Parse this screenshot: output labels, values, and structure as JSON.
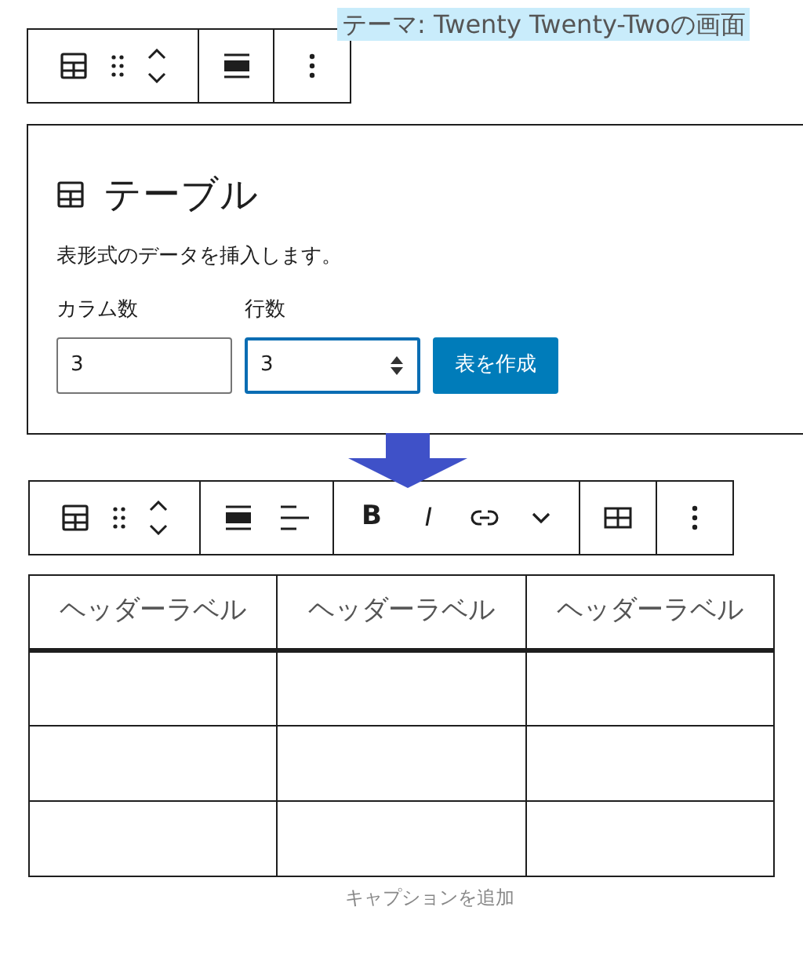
{
  "theme_label": "テーマ: Twenty Twenty-Twoの画面",
  "toolbar_top": {
    "groups": [
      [
        {
          "kind": "table"
        },
        {
          "kind": "drag"
        },
        {
          "kind": "move"
        }
      ],
      [
        {
          "kind": "align"
        }
      ],
      [
        {
          "kind": "more"
        }
      ]
    ]
  },
  "placeholder": {
    "title": "テーブル",
    "description": "表形式のデータを挿入します。",
    "fields": [
      {
        "label": "カラム数",
        "value": "3",
        "focused": false
      },
      {
        "label": "行数",
        "value": "3",
        "focused": true
      }
    ],
    "button": "表を作成"
  },
  "toolbar_bottom": {
    "groups": [
      [
        {
          "kind": "table"
        },
        {
          "kind": "drag"
        },
        {
          "kind": "move"
        }
      ],
      [
        {
          "kind": "align"
        },
        {
          "kind": "text-align"
        }
      ],
      [
        {
          "kind": "text",
          "label": "B"
        },
        {
          "kind": "text",
          "label": "I"
        },
        {
          "kind": "link"
        },
        {
          "kind": "chevron"
        }
      ],
      [
        {
          "kind": "grid"
        }
      ],
      [
        {
          "kind": "more"
        }
      ]
    ]
  },
  "table": {
    "columns": [
      "ヘッダーラベル",
      "ヘッダーラベル",
      "ヘッダーラベル"
    ],
    "rows": [
      {
        "kind": "empty"
      },
      {
        "kind": "empty"
      },
      {
        "kind": "empty"
      }
    ]
  },
  "caption_placeholder": "キャプションを追加"
}
